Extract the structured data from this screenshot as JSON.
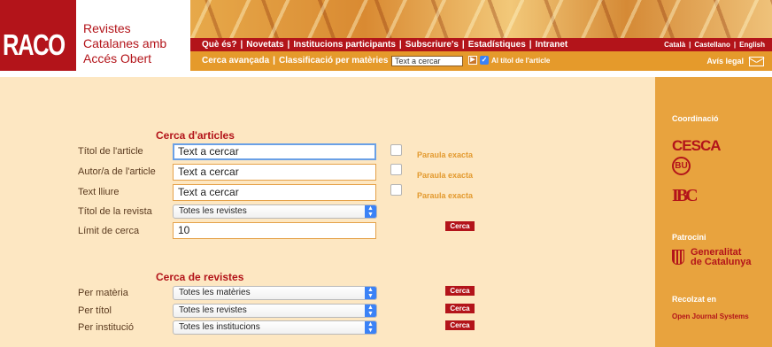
{
  "header": {
    "logo_text": "RACO",
    "site_name": "Revistes Catalanes amb Accés Obert",
    "nav_main": [
      "Què és?",
      "Novetats",
      "Institucions participants",
      "Subscriure's",
      "Estadístiques",
      "Intranet"
    ],
    "languages": [
      "Català",
      "Castellano",
      "English"
    ],
    "nav_secondary": [
      "Cerca avançada",
      "Classificació per matèries"
    ],
    "search_value": "Text a cercar",
    "title_only_label": "Al títol de l'article",
    "legal_label": "Avís legal"
  },
  "articles": {
    "title": "Cerca d'articles",
    "rows": [
      {
        "label": "Títol de l'article",
        "value": "Text a cercar",
        "exact": "Paraula exacta"
      },
      {
        "label": "Autor/a de l'article",
        "value": "Text a cercar",
        "exact": "Paraula exacta"
      },
      {
        "label": "Text lliure",
        "value": "Text a cercar",
        "exact": "Paraula exacta"
      }
    ],
    "journal_label": "Títol de la revista",
    "journal_value": "Totes les revistes",
    "limit_label": "Límit de cerca",
    "limit_value": "10",
    "search_button": "Cerca"
  },
  "journals": {
    "title": "Cerca de revistes",
    "rows": [
      {
        "label": "Per matèria",
        "value": "Totes les matèries",
        "button": "Cerca"
      },
      {
        "label": "Per títol",
        "value": "Totes les revistes",
        "button": "Cerca"
      },
      {
        "label": "Per institució",
        "value": "Totes les institucions",
        "button": "Cerca"
      }
    ]
  },
  "sidebar": {
    "coordination_label": "Coordinació",
    "logos": [
      "CESCA",
      "BU",
      "IBC"
    ],
    "sponsor_label": "Patrocini",
    "sponsor_name_1": "Generalitat",
    "sponsor_name_2": "de Catalunya",
    "collected_label": "Recolzat en",
    "collected_name": "Open Journal Systems"
  },
  "colors": {
    "brand_red": "#b3141a",
    "orange": "#e59a2b",
    "sidebar": "#e8a33e",
    "panel": "#fde7c2"
  }
}
